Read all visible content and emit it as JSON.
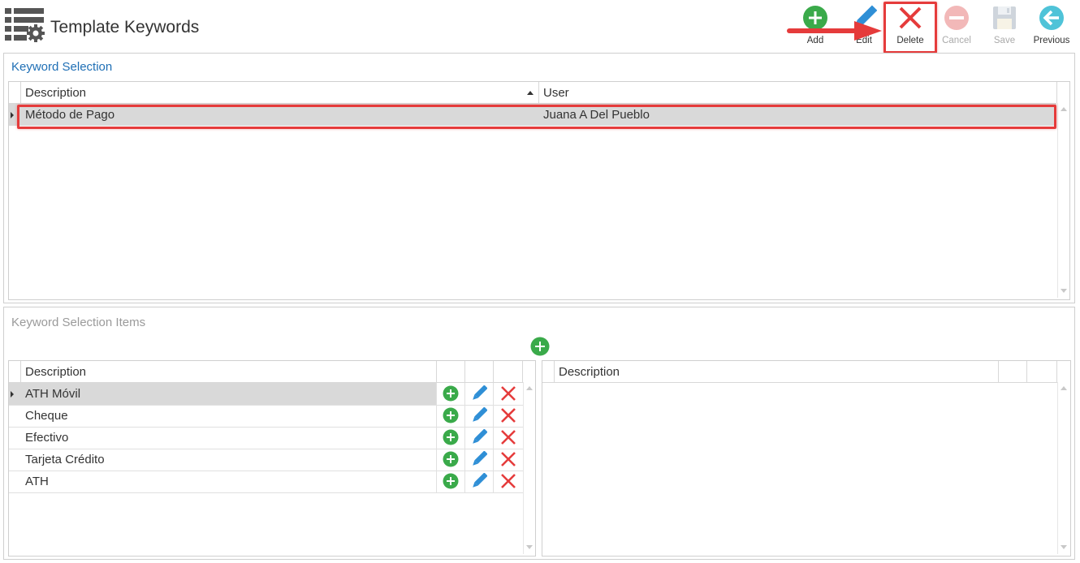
{
  "header": {
    "title": "Template Keywords",
    "app_icon": "list-gear-icon"
  },
  "toolbar": {
    "buttons": [
      {
        "label": "Add",
        "icon": "plus-circle-icon",
        "enabled": true
      },
      {
        "label": "Edit",
        "icon": "pencil-icon",
        "enabled": true
      },
      {
        "label": "Delete",
        "icon": "x-icon",
        "enabled": true,
        "highlighted": true
      },
      {
        "label": "Cancel",
        "icon": "minus-circle-icon",
        "enabled": false
      },
      {
        "label": "Save",
        "icon": "floppy-disk-icon",
        "enabled": false
      },
      {
        "label": "Previous",
        "icon": "arrow-left-circle-icon",
        "enabled": true
      }
    ]
  },
  "keyword_selection": {
    "title": "Keyword Selection",
    "columns": [
      "Description",
      "User"
    ],
    "sort_column": "Description",
    "rows": [
      {
        "description": "Método de Pago",
        "user": "Juana A Del Pueblo",
        "selected": true
      }
    ]
  },
  "keyword_selection_items": {
    "title": "Keyword Selection Items",
    "add_icon": "plus-circle-icon",
    "left_grid": {
      "columns": [
        "Description"
      ],
      "rows": [
        {
          "description": "ATH Móvil",
          "selected": true
        },
        {
          "description": "Cheque"
        },
        {
          "description": "Efectivo"
        },
        {
          "description": "Tarjeta Crédito"
        },
        {
          "description": "ATH"
        }
      ],
      "row_actions": [
        "plus-circle-icon",
        "pencil-icon",
        "x-icon"
      ]
    },
    "right_grid": {
      "columns": [
        "Description"
      ],
      "rows": []
    }
  },
  "colors": {
    "accent_blue": "#1f6fb5",
    "green": "#3aaa4a",
    "red": "#e53b3b",
    "pencil_blue": "#2f8fd6",
    "disabled": "#c8c8c8",
    "selected_row": "#d9d9d9"
  }
}
